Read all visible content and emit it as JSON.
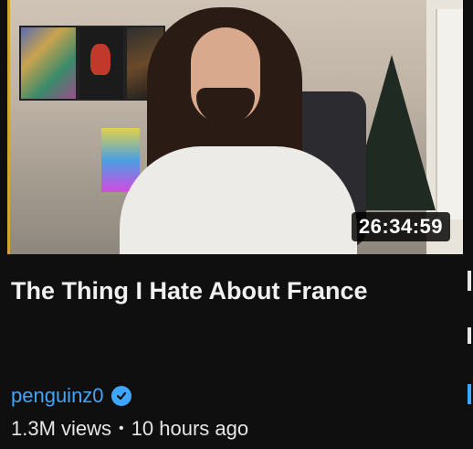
{
  "video": {
    "title": "The Thing I Hate About France",
    "duration": "26:34:59",
    "channel": "penguinz0",
    "verified": true,
    "views": "1.3M views",
    "separator": "•",
    "age": "10 hours ago"
  },
  "colors": {
    "background": "#0f0f0f",
    "channel_link": "#3ea6ff",
    "title_text": "#f1f1f1"
  },
  "icons": {
    "verified": "verified-check-icon"
  }
}
